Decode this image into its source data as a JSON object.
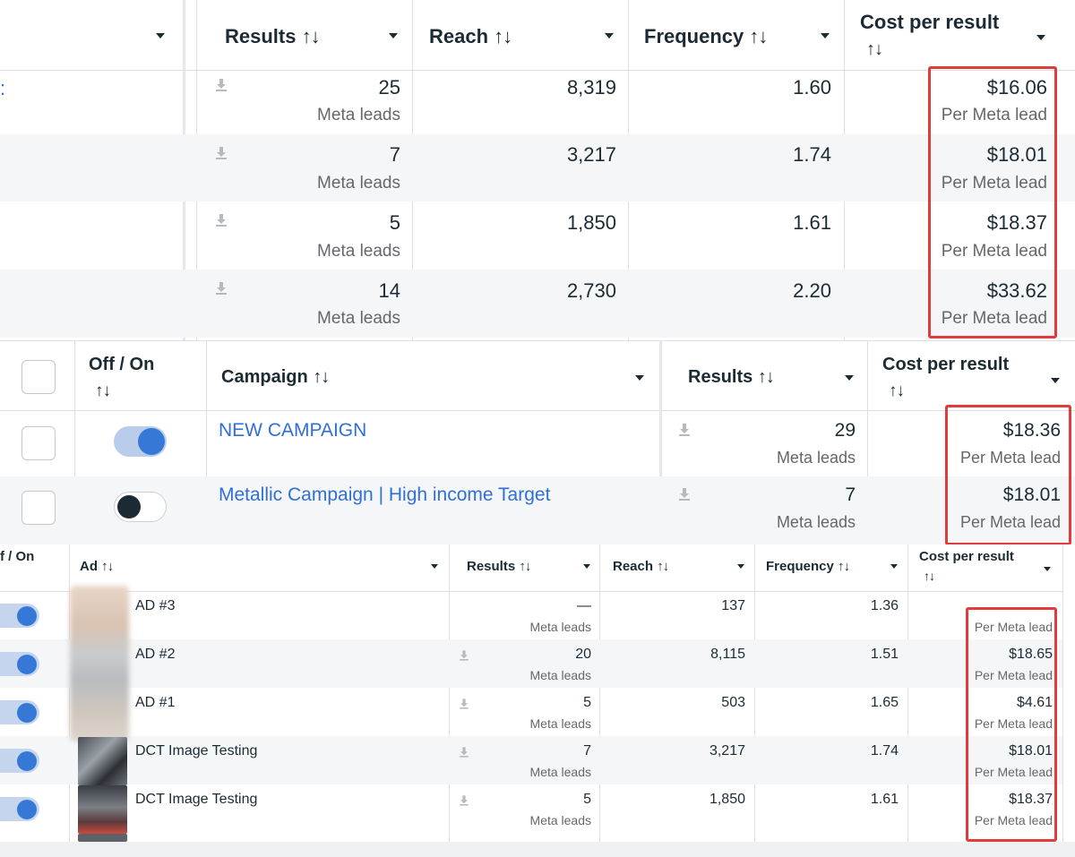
{
  "top_table": {
    "headers": {
      "results": "Results",
      "reach": "Reach",
      "frequency": "Frequency",
      "cost_per_result": "Cost per result",
      "sort_icon": "↑↓"
    },
    "link_fragment": ":",
    "rows": [
      {
        "results": "25",
        "result_type": "Meta leads",
        "reach": "8,319",
        "frequency": "1.60",
        "cost": "$16.06",
        "cost_label": "Per Meta lead"
      },
      {
        "results": "7",
        "result_type": "Meta leads",
        "reach": "3,217",
        "frequency": "1.74",
        "cost": "$18.01",
        "cost_label": "Per Meta lead"
      },
      {
        "results": "5",
        "result_type": "Meta leads",
        "reach": "1,850",
        "frequency": "1.61",
        "cost": "$18.37",
        "cost_label": "Per Meta lead"
      },
      {
        "results": "14",
        "result_type": "Meta leads",
        "reach": "2,730",
        "frequency": "2.20",
        "cost": "$33.62",
        "cost_label": "Per Meta lead"
      }
    ]
  },
  "campaign_table": {
    "headers": {
      "off_on": "Off / On",
      "campaign": "Campaign",
      "results": "Results",
      "cost_per_result": "Cost per result",
      "sort_icon": "↑↓"
    },
    "rows": [
      {
        "name": "NEW CAMPAIGN",
        "toggle_on": true,
        "results": "29",
        "result_type": "Meta leads",
        "cost": "$18.36",
        "cost_label": "Per Meta lead"
      },
      {
        "name": "Metallic Campaign | High income Target",
        "toggle_on": false,
        "results": "7",
        "result_type": "Meta leads",
        "cost": "$18.01",
        "cost_label": "Per Meta lead"
      }
    ]
  },
  "ad_table": {
    "headers": {
      "off_on": "f / On",
      "ad": "Ad",
      "results": "Results",
      "reach": "Reach",
      "frequency": "Frequency",
      "cost_per_result": "Cost per result",
      "sort_icon": "↑↓"
    },
    "rows": [
      {
        "name": "AD #3",
        "results": "—",
        "result_type": "Meta leads",
        "reach": "137",
        "frequency": "1.36",
        "cost": "",
        "cost_label": "Per Meta lead"
      },
      {
        "name": "AD #2",
        "results": "20",
        "result_type": "Meta leads",
        "reach": "8,115",
        "frequency": "1.51",
        "cost": "$18.65",
        "cost_label": "Per Meta lead"
      },
      {
        "name": "AD #1",
        "results": "5",
        "result_type": "Meta leads",
        "reach": "503",
        "frequency": "1.65",
        "cost": "$4.61",
        "cost_label": "Per Meta lead"
      },
      {
        "name": "DCT Image Testing",
        "results": "7",
        "result_type": "Meta leads",
        "reach": "3,217",
        "frequency": "1.74",
        "cost": "$18.01",
        "cost_label": "Per Meta lead"
      },
      {
        "name": "DCT Image Testing",
        "results": "5",
        "result_type": "Meta leads",
        "reach": "1,850",
        "frequency": "1.61",
        "cost": "$18.37",
        "cost_label": "Per Meta lead"
      }
    ]
  },
  "colors": {
    "accent_blue": "#3578d6",
    "highlight_red": "#e03c3c",
    "row_alt": "#f5f6f7",
    "link": "#2f6fd6"
  }
}
